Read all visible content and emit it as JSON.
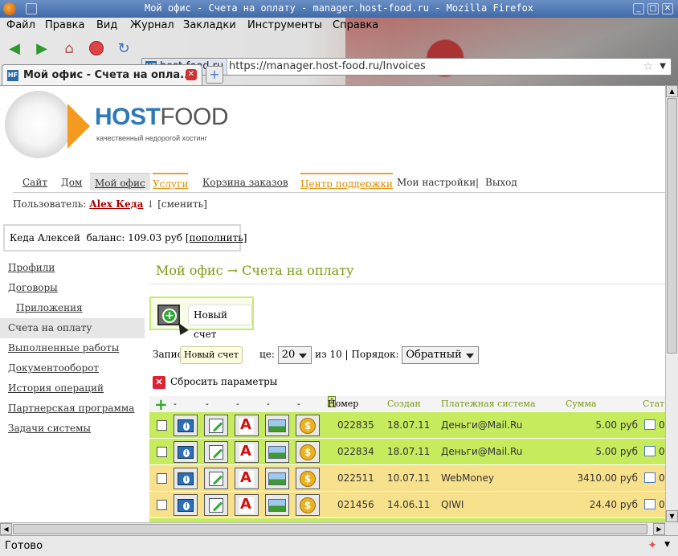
{
  "window": {
    "title": "Мой офис - Счета на оплату - manager.host-food.ru - Mozilla Firefox",
    "btn_min": "_",
    "btn_max": "□",
    "btn_close": "✕"
  },
  "menubar": {
    "items": [
      "Файл",
      "Правка",
      "Вид",
      "Журнал",
      "Закладки",
      "Инструменты",
      "Справка"
    ]
  },
  "addressbar": {
    "site": "host-food.ru",
    "url": "https://manager.host-food.ru/Invoices"
  },
  "tabs": [
    {
      "label": "Мой офис - Счета на опла...",
      "favicon": "HF"
    }
  ],
  "logo": {
    "part1": "HOST",
    "part2": "FOOD",
    "tagline": "качественный недорогой хостинг"
  },
  "topnav": {
    "items": [
      "Сайт",
      "Дом",
      "Мой офис",
      "Услуги",
      "Корзина заказов",
      "Центр поддержки",
      "Мои настройки",
      "|",
      "Выход"
    ]
  },
  "user": {
    "label": "Пользователь:",
    "name": "Alex Кеда",
    "arrow": "↓",
    "change": "[сменить]"
  },
  "balance": {
    "text": "Кеда Алексей  баланс: 109.03 руб ",
    "topup": "[пополнить]"
  },
  "sidebar": {
    "items": [
      "Профили",
      "Договоры",
      "Приложения",
      "Счета на оплату",
      "Выполненные работы",
      "Документооборот",
      "История операций",
      "Партнерская программа",
      "Задачи системы"
    ]
  },
  "page": {
    "title": "Мой офис → Счета на оплату",
    "new_invoice": "Новый счет",
    "tooltip": "Новый счет",
    "records_prefix": "Запис",
    "records_suffix": "це:",
    "per_page": "20",
    "of_total": "из 10 | Порядок:",
    "order": "Обратный",
    "reset": "Сбросить параметры"
  },
  "table": {
    "dash": "-",
    "headers": {
      "number": "Номер",
      "created": "Создан",
      "system": "Платежная система",
      "sum": "Сумма",
      "status": "Стат"
    },
    "rows": [
      {
        "number": "022835",
        "created": "18.07.11",
        "system": "Деньги@Mail.Ru",
        "sum": "5.00 руб",
        "status": "0",
        "color": "#c6ec5e"
      },
      {
        "number": "022834",
        "created": "18.07.11",
        "system": "Деньги@Mail.Ru",
        "sum": "5.00 руб",
        "status": "0",
        "color": "#c6ec5e"
      },
      {
        "number": "022511",
        "created": "10.07.11",
        "system": "WebMoney",
        "sum": "3410.00 руб",
        "status": "0",
        "color": "#f8e18c"
      },
      {
        "number": "021456",
        "created": "14.06.11",
        "system": "QIWI",
        "sum": "24.40 руб",
        "status": "0",
        "color": "#f8e18c"
      }
    ]
  },
  "status": {
    "text": "Готово"
  },
  "colors": {
    "accent_green": "#7a9a10",
    "brand_blue": "#2e79b6",
    "brand_orange": "#f39a1f"
  }
}
